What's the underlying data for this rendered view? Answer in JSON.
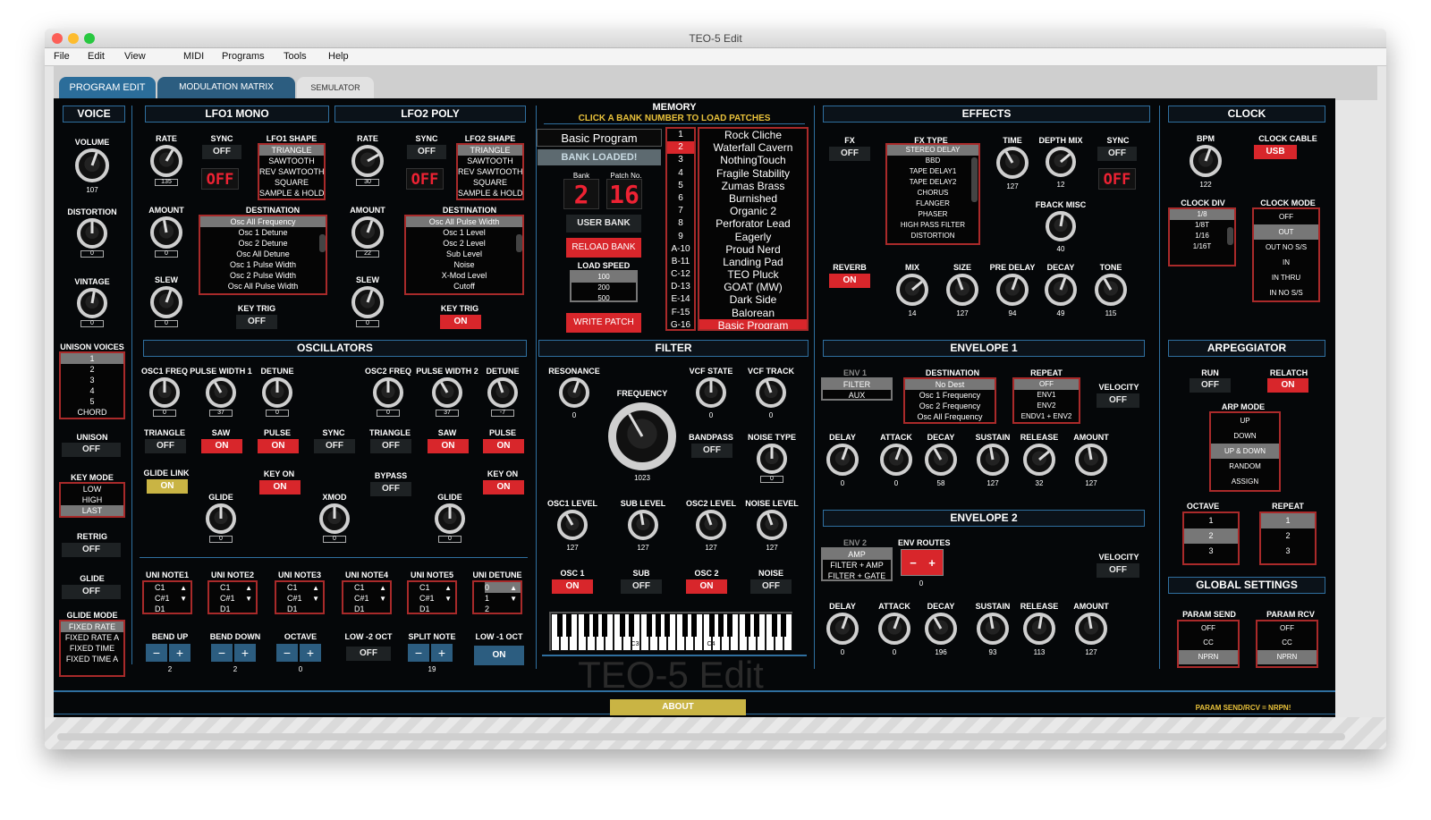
{
  "window": {
    "title": "TEO-5 Edit"
  },
  "menu": [
    "File",
    "Edit",
    "View",
    "MIDI",
    "Programs",
    "Tools",
    "Help"
  ],
  "tabs": [
    "PROGRAM EDIT",
    "MODULATION MATRIX",
    "SEMULATOR"
  ],
  "voice": {
    "title": "VOICE",
    "volume_label": "VOLUME",
    "volume": "107",
    "distortion_label": "DISTORTION",
    "distortion": "0",
    "vintage_label": "VINTAGE",
    "vintage": "0",
    "unison_voices_label": "UNISON VOICES",
    "unison_voices": [
      "1",
      "2",
      "3",
      "4",
      "5",
      "CHORD"
    ],
    "unison_label": "UNISON",
    "unison": "OFF",
    "key_mode_label": "KEY MODE",
    "key_modes": [
      "LOW",
      "HIGH",
      "LAST"
    ],
    "retrig_label": "RETRIG",
    "retrig": "OFF",
    "glide_label": "GLIDE",
    "glide": "OFF",
    "glide_mode_label": "GLIDE MODE",
    "glide_modes": [
      "FIXED RATE",
      "FIXED RATE A",
      "FIXED TIME",
      "FIXED TIME A"
    ]
  },
  "lfo1": {
    "title": "LFO1 MONO",
    "rate_label": "RATE",
    "rate": "135",
    "sync_label": "SYNC",
    "sync": "OFF",
    "display": "OFF",
    "shape_label": "LFO1 SHAPE",
    "shapes": [
      "TRIANGLE",
      "SAWTOOTH",
      "REV SAWTOOTH",
      "SQUARE",
      "SAMPLE & HOLD"
    ],
    "amount_label": "AMOUNT",
    "amount": "0",
    "slew_label": "SLEW",
    "slew": "0",
    "dest_label": "DESTINATION",
    "destinations": [
      "Osc All Frequency",
      "Osc 1 Detune",
      "Osc 2 Detune",
      "Osc All Detune",
      "Osc 1 Pulse Width",
      "Osc 2 Pulse Width",
      "Osc All Pulse Width"
    ],
    "keytrig_label": "KEY TRIG",
    "keytrig": "OFF"
  },
  "lfo2": {
    "title": "LFO2 POLY",
    "rate_label": "RATE",
    "rate": "30",
    "sync_label": "SYNC",
    "sync": "OFF",
    "display": "OFF",
    "shape_label": "LFO2 SHAPE",
    "shapes": [
      "TRIANGLE",
      "SAWTOOTH",
      "REV SAWTOOTH",
      "SQUARE",
      "SAMPLE & HOLD"
    ],
    "amount_label": "AMOUNT",
    "amount": "22",
    "slew_label": "SLEW",
    "slew": "0",
    "dest_label": "DESTINATION",
    "destinations": [
      "Osc All Pulse Width",
      "Osc 1 Level",
      "Osc 2 Level",
      "Sub Level",
      "Noise",
      "X-Mod Level",
      "Cutoff"
    ],
    "keytrig_label": "KEY TRIG",
    "keytrig": "ON"
  },
  "oscillators": {
    "title": "OSCILLATORS",
    "osc1_freq_label": "OSC1 FREQ",
    "osc1_freq": "0",
    "pw1_label": "PULSE WIDTH 1",
    "pw1": "37",
    "detune1_label": "DETUNE",
    "detune1": "0",
    "osc2_freq_label": "OSC2 FREQ",
    "osc2_freq": "0",
    "pw2_label": "PULSE WIDTH 2",
    "pw2": "37",
    "detune2_label": "DETUNE",
    "detune2": "-7",
    "tri1_label": "TRIANGLE",
    "tri1": "OFF",
    "saw1_label": "SAW",
    "saw1": "ON",
    "pulse1_label": "PULSE",
    "pulse1": "ON",
    "sync_label": "SYNC",
    "sync": "OFF",
    "tri2_label": "TRIANGLE",
    "tri2": "OFF",
    "saw2_label": "SAW",
    "saw2": "ON",
    "pulse2_label": "PULSE",
    "pulse2": "ON",
    "glidelink_label": "GLIDE LINK",
    "glidelink": "ON",
    "keyon1_label": "KEY ON",
    "keyon1": "ON",
    "bypass_label": "BYPASS",
    "bypass": "OFF",
    "keyon2_label": "KEY ON",
    "keyon2": "ON",
    "glide1_label": "GLIDE",
    "glide1": "0",
    "xmod_label": "XMOD",
    "xmod": "0",
    "glide2_label": "GLIDE",
    "glide2": "0"
  },
  "uni": {
    "note1_label": "UNI NOTE1",
    "note2_label": "UNI NOTE2",
    "note3_label": "UNI NOTE3",
    "note4_label": "UNI NOTE4",
    "note5_label": "UNI NOTE5",
    "detune_label": "UNI DETUNE",
    "notes": [
      "C1",
      "C#1",
      "D1"
    ],
    "detunes": [
      "0",
      "1",
      "2"
    ],
    "bendup_label": "BEND UP",
    "bendup": "2",
    "benddown_label": "BEND DOWN",
    "benddown": "2",
    "octave_label": "OCTAVE",
    "octave": "0",
    "low2_label": "LOW -2 OCT",
    "low2": "OFF",
    "split_label": "SPLIT NOTE",
    "split": "19",
    "low1_label": "LOW -1 OCT",
    "low1": "ON"
  },
  "memory": {
    "title": "MEMORY",
    "subtitle": "CLICK A BANK NUMBER TO LOAD PATCHES",
    "program_name": "Basic Program",
    "bank_loaded": "BANK LOADED!",
    "bank_label": "Bank",
    "bank": "2",
    "patch_label": "Patch No.",
    "patch": "16",
    "user_bank": "USER BANK",
    "reload_bank": "RELOAD BANK",
    "load_speed_label": "LOAD SPEED",
    "load_speeds": [
      "100",
      "200",
      "500"
    ],
    "write_patch": "WRITE PATCH",
    "banks": [
      "1",
      "2",
      "3",
      "4",
      "5",
      "6",
      "7",
      "8",
      "9",
      "A-10",
      "B-11",
      "C-12",
      "D-13",
      "E-14",
      "F-15",
      "G-16"
    ],
    "patches": [
      "Rock Cliche",
      "Waterfall Cavern",
      "NothingTouch",
      "Fragile Stability",
      "Zumas Brass",
      "Burnished",
      "Organic 2",
      "Perforator Lead",
      "Eagerly",
      "Proud Nerd",
      "Landing Pad",
      "TEO Pluck",
      "GOAT (MW)",
      "Dark Side",
      "Balorean",
      "Basic Program"
    ]
  },
  "filter": {
    "title": "FILTER",
    "resonance_label": "RESONANCE",
    "resonance": "0",
    "frequency_label": "FREQUENCY",
    "frequency": "1023",
    "vcfstate_label": "VCF STATE",
    "vcfstate": "0",
    "vcftrack_label": "VCF TRACK",
    "vcftrack": "0",
    "bandpass_label": "BANDPASS",
    "bandpass": "OFF",
    "noisetype_label": "NOISE TYPE",
    "noisetype": "0",
    "osc1level_label": "OSC1 LEVEL",
    "osc1level": "127",
    "sublevel_label": "SUB LEVEL",
    "sublevel": "127",
    "osc2level_label": "OSC2 LEVEL",
    "osc2level": "127",
    "noiselevel_label": "NOISE LEVEL",
    "noiselevel": "127",
    "osc1_label": "OSC 1",
    "osc1": "ON",
    "sub_label": "SUB",
    "sub": "OFF",
    "osc2_label": "OSC 2",
    "osc2": "ON",
    "noise_label": "NOISE",
    "noise": "OFF",
    "keys": [
      "C3",
      "C4"
    ],
    "watermark": "TEO-5 Edit"
  },
  "effects": {
    "title": "EFFECTS",
    "fx_label": "FX",
    "fx": "OFF",
    "fxtype_label": "FX TYPE",
    "fxtypes": [
      "STEREO DELAY",
      "BBD",
      "TAPE DELAY1",
      "TAPE DELAY2",
      "CHORUS",
      "FLANGER",
      "PHASER",
      "HIGH PASS FILTER",
      "DISTORTION"
    ],
    "time_label": "TIME",
    "time": "127",
    "depth_label": "DEPTH MIX",
    "depth": "12",
    "sync_label": "SYNC",
    "sync": "OFF",
    "display": "OFF",
    "fback_label": "FBACK MISC",
    "fback": "40",
    "reverb_label": "REVERB",
    "reverb": "ON",
    "mix_label": "MIX",
    "mix": "14",
    "size_label": "SIZE",
    "size": "127",
    "predelay_label": "PRE DELAY",
    "predelay": "94",
    "decay_label": "DECAY",
    "decay": "49",
    "tone_label": "TONE",
    "tone": "115"
  },
  "env1": {
    "title": "ENVELOPE 1",
    "env_label": "ENV 1",
    "env_items": [
      "FILTER",
      "AUX"
    ],
    "dest_label": "DESTINATION",
    "destinations": [
      "No Dest",
      "Osc 1 Frequency",
      "Osc 2 Frequency",
      "Osc All Frequency"
    ],
    "repeat_label": "REPEAT",
    "repeats": [
      "OFF",
      "ENV1",
      "ENV2",
      "ENDV1 + ENV2"
    ],
    "velocity_label": "VELOCITY",
    "velocity": "OFF",
    "delay_label": "DELAY",
    "delay": "0",
    "attack_label": "ATTACK",
    "attack": "0",
    "decay_label": "DECAY",
    "decay": "58",
    "sustain_label": "SUSTAIN",
    "sustain": "127",
    "release_label": "RELEASE",
    "release": "32",
    "amount_label": "AMOUNT",
    "amount": "127"
  },
  "env2": {
    "title": "ENVELOPE 2",
    "env_label": "ENV 2",
    "env_items": [
      "AMP",
      "FILTER + AMP",
      "FILTER + GATE"
    ],
    "routes_label": "ENV ROUTES",
    "routes": "0",
    "velocity_label": "VELOCITY",
    "velocity": "OFF",
    "delay_label": "DELAY",
    "delay": "0",
    "attack_label": "ATTACK",
    "attack": "0",
    "decay_label": "DECAY",
    "decay": "196",
    "sustain_label": "SUSTAIN",
    "sustain": "93",
    "release_label": "RELEASE",
    "release": "113",
    "amount_label": "AMOUNT",
    "amount": "127"
  },
  "clock": {
    "title": "CLOCK",
    "bpm_label": "BPM",
    "bpm": "122",
    "cable_label": "CLOCK CABLE",
    "cable": "USB",
    "div_label": "CLOCK DIV",
    "divs": [
      "1/8",
      "1/8T",
      "1/16",
      "1/16T"
    ],
    "mode_label": "CLOCK MODE",
    "modes": [
      "OFF",
      "OUT",
      "OUT NO S/S",
      "IN",
      "IN THRU",
      "IN NO S/S"
    ]
  },
  "arp": {
    "title": "ARPEGGIATOR",
    "run_label": "RUN",
    "run": "OFF",
    "relatch_label": "RELATCH",
    "relatch": "ON",
    "mode_label": "ARP MODE",
    "modes": [
      "UP",
      "DOWN",
      "UP & DOWN",
      "RANDOM",
      "ASSIGN"
    ],
    "octave_label": "OCTAVE",
    "octaves": [
      "1",
      "2",
      "3"
    ],
    "repeat_label": "REPEAT",
    "repeats": [
      "1",
      "2",
      "3"
    ]
  },
  "global": {
    "title": "GLOBAL SETTINGS",
    "send_label": "PARAM SEND",
    "send": [
      "OFF",
      "CC",
      "NPRN"
    ],
    "rcv_label": "PARAM RCV",
    "rcv": [
      "OFF",
      "CC",
      "NPRN"
    ]
  },
  "footer": {
    "about": "ABOUT",
    "status": "PARAM SEND/RCV  =  NRPN!"
  }
}
